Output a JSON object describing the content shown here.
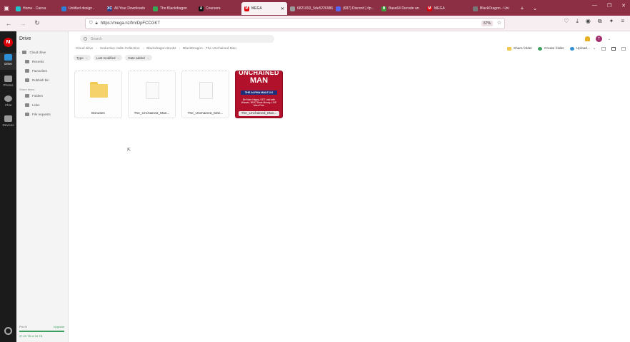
{
  "browser": {
    "tabs": [
      {
        "label": "Home - Canva",
        "fav_color": "#20c4cb",
        "fav_text": ""
      },
      {
        "label": "Untitled design - ",
        "fav_color": "#2b7fd6",
        "fav_text": ""
      },
      {
        "label": "All Your Downloads",
        "fav_color": "#2a3f8a",
        "fav_text": "XC"
      },
      {
        "label": "The Blackdragon ",
        "fav_color": "#34a853",
        "fav_text": ""
      },
      {
        "label": "Coursera",
        "fav_color": "#111111",
        "fav_text": "A"
      },
      {
        "label": "MEGA",
        "fav_color": "#d90007",
        "fav_text": "M",
        "active": true,
        "close": "✕"
      },
      {
        "label": "6821093_5de5226986...",
        "fav_color": "#9a9a9a",
        "fav_text": ""
      },
      {
        "label": "(687) Discord | #p...",
        "fav_color": "#5865f2",
        "fav_text": ""
      },
      {
        "label": "Base64 Decode an",
        "fav_color": "#3c9a3c",
        "fav_text": "B"
      },
      {
        "label": "MEGA",
        "fav_color": "#d90007",
        "fav_text": "M"
      },
      {
        "label": "BlackDragon - Uni",
        "fav_color": "#777777",
        "fav_text": ""
      }
    ],
    "new_tab": "+",
    "tab_list": "⌄",
    "window_controls": {
      "minimize": "—",
      "restore": "❐",
      "close": "✕"
    },
    "url": "https://mega.nz/fm/DpFCCGKT",
    "zoom": "67%",
    "nav_icons": [
      "pocket-icon",
      "download-icon",
      "account-icon",
      "extensions-icon",
      "shield-icon",
      "menu-icon"
    ]
  },
  "rail": {
    "logo": "M",
    "items": [
      {
        "label": "Drive",
        "active": true
      },
      {
        "label": "Photos"
      },
      {
        "label": "Chat"
      },
      {
        "label": "Devices"
      }
    ]
  },
  "sidebar": {
    "title": "Drive",
    "items": [
      {
        "label": "Cloud drive",
        "chevron": "›"
      },
      {
        "label": "Recents"
      },
      {
        "label": "Favourites"
      },
      {
        "label": "Rubbish bin"
      }
    ],
    "section": "Share items",
    "share_items": [
      {
        "label": "Folders"
      },
      {
        "label": "Links"
      },
      {
        "label": "File requests"
      }
    ],
    "storage": {
      "plan": "Pro III",
      "upgrade": "Upgrade",
      "used_text": "37.29 TB of 16 TB",
      "used_fraction": 1.0
    }
  },
  "main": {
    "search_placeholder": "Search",
    "avatar": "T",
    "breadcrumb": [
      "Cloud drive",
      "Seductive Hulle Collection",
      "Blackdragon Books",
      "BlackDragon - The Unchained Man"
    ],
    "breadcrumb_sep": "›",
    "actions": {
      "share_folder": "Share folder",
      "create_folder": "Create folder",
      "upload": "Upload...",
      "upload_caret": "⌄"
    },
    "filters": [
      {
        "label": "Type"
      },
      {
        "label": "Last modified"
      },
      {
        "label": "Date added"
      }
    ],
    "filter_caret": "⌄",
    "items": [
      {
        "name": "Bonuses",
        "kind": "folder"
      },
      {
        "name": "The_Unchained_Man...",
        "kind": "file"
      },
      {
        "name": "The_Unchained_Man...",
        "kind": "file"
      },
      {
        "name": "The_Unchained_Man...",
        "kind": "cover",
        "cover_line1": "UNCHAINED",
        "cover_line2": "MAN",
        "cover_line3": "THE ALPHA MALE 2.0",
        "cover_line4": "Be More Happy, GET Laid with Women, BEAT More Money, LIVE More Free"
      }
    ]
  }
}
